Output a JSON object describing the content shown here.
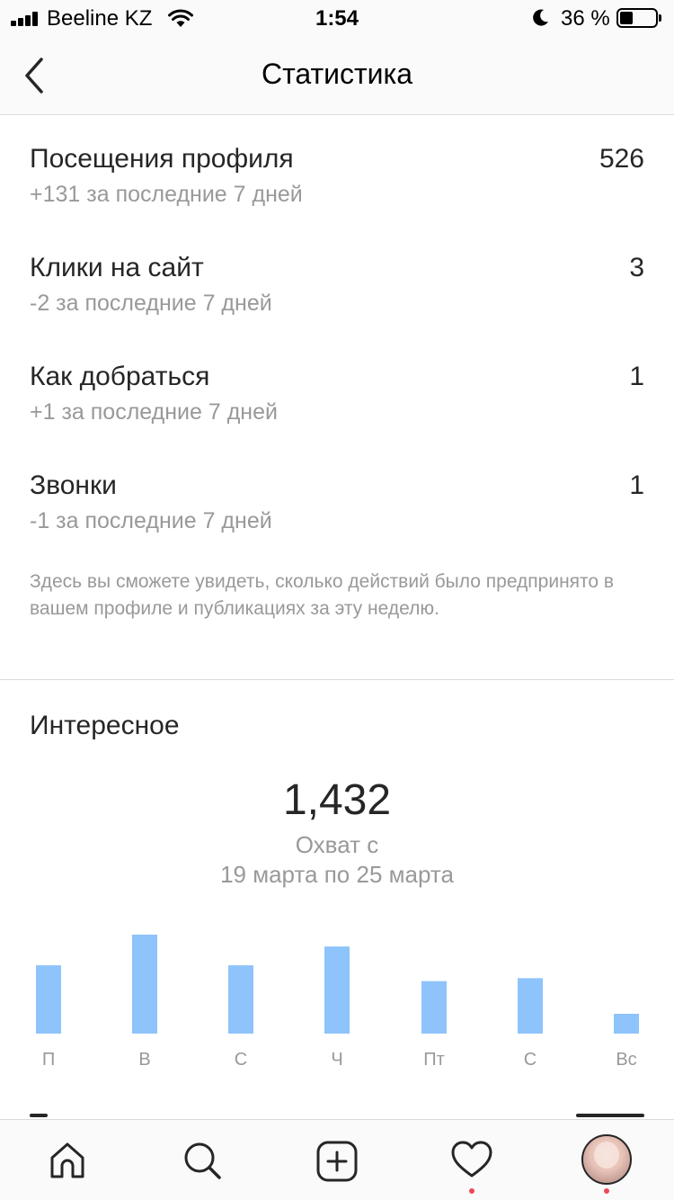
{
  "status_bar": {
    "carrier": "Beeline KZ",
    "time": "1:54",
    "battery_percent_text": "36 %",
    "battery_level": 0.36,
    "icons": [
      "signal-icon",
      "wifi-icon",
      "moon-icon",
      "battery-icon"
    ]
  },
  "nav": {
    "title": "Статистика",
    "back_icon": "chevron-left-icon"
  },
  "metrics": [
    {
      "label": "Посещения профиля",
      "sub": "+131 за последние 7 дней",
      "value": "526"
    },
    {
      "label": "Клики на сайт",
      "sub": "-2 за последние 7 дней",
      "value": "3"
    },
    {
      "label": "Как добраться",
      "sub": "+1 за последние 7 дней",
      "value": "1"
    },
    {
      "label": "Звонки",
      "sub": "-1 за последние 7 дней",
      "value": "1"
    }
  ],
  "info_text": "Здесь вы сможете увидеть, сколько действий было предпринято в вашем профиле и публикациях за эту неделю.",
  "discovery": {
    "title": "Интересное",
    "reach_value": "1,432",
    "reach_label": "Охват с",
    "reach_period": "19 марта по 25 марта"
  },
  "chart_data": {
    "type": "bar",
    "categories": [
      "П",
      "В",
      "С",
      "Ч",
      "Пт",
      "С",
      "Вс"
    ],
    "values": [
      0.69,
      1.0,
      0.69,
      0.88,
      0.53,
      0.56,
      0.2
    ],
    "ylim": [
      0,
      1
    ],
    "bar_color": "#8ec3fb",
    "grid": false,
    "legend": "none"
  },
  "tab_bar": {
    "tabs": [
      {
        "name": "home",
        "icon": "home-icon",
        "dot": false
      },
      {
        "name": "search",
        "icon": "search-icon",
        "dot": false
      },
      {
        "name": "new-post",
        "icon": "plus-square-icon",
        "dot": false
      },
      {
        "name": "activity",
        "icon": "heart-icon",
        "dot": true
      },
      {
        "name": "profile",
        "icon": "avatar",
        "dot": true
      }
    ],
    "notification_color": "#ed4956"
  },
  "colors": {
    "primary_text": "#262626",
    "secondary_text": "#999999",
    "divider": "#dbdbdb",
    "bar": "#8ec3fb"
  }
}
